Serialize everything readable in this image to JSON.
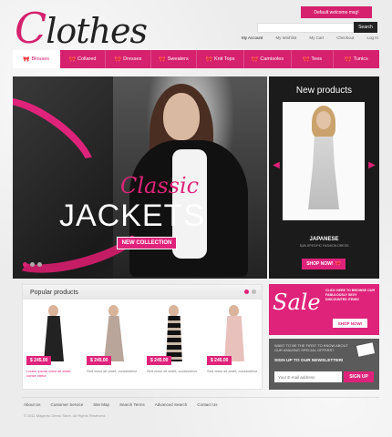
{
  "header": {
    "logo": "Clothes",
    "welcome": "Default welcome msg!",
    "search_placeholder": "",
    "search_button": "Search",
    "top_links": [
      "My Account",
      "My Wishlist",
      "My Cart",
      "Checkout",
      "Log In"
    ]
  },
  "nav": {
    "items": [
      "Blouses",
      "Collared",
      "Dresses",
      "Sweaters",
      "Knit Tops",
      "Camisoles",
      "Tees",
      "Tunics"
    ],
    "active": "Blouses"
  },
  "hero": {
    "classic": "Classic",
    "jackets": "JACKETS",
    "button": "NEW COLLECTION",
    "slide_count": 3,
    "active_slide": 1
  },
  "new_products": {
    "title": "New products",
    "product_name": "JAPANESE",
    "product_sub": "SUB-SPECIFIC FASHION DRESS",
    "button": "SHOP NOW!"
  },
  "popular": {
    "title": "Popular products",
    "items": [
      {
        "price": "$ 245.00",
        "desc": "Lorem ipsum dolor sit amet, conse ctetur"
      },
      {
        "price": "$ 245.00",
        "desc": "Sed dolor sit amet, consectetur"
      },
      {
        "price": "$ 245.00",
        "desc": "Sed dolor sit amet, consectetur"
      },
      {
        "price": "$ 245.00",
        "desc": "Sed dolor sit amet, consectetur"
      }
    ]
  },
  "sale": {
    "word": "Sale",
    "text": "CLICK HERE TO BROWSE OUR FABULOUSLY SEXY DISCOUNTED ITEMS!",
    "button": "SHOP NOW!"
  },
  "newsletter": {
    "line1": "WANT TO BE THE FIRST TO KNOW ABOUT OUR AMAZING SPECIAL OFFERS?",
    "line2": "SIGN UP TO OUR NEWSLETTER!",
    "placeholder": "Your E-mail address",
    "button": "SIGN UP"
  },
  "footer": {
    "links": [
      "About Us",
      "Customer Service",
      "Site Map",
      "Search Terms",
      "Advanced Search",
      "Contact Us"
    ],
    "copyright": "© 2011 Magento Demo Store. All Rights Reserved."
  },
  "colors": {
    "accent": "#e0237a",
    "dark": "#1b1b1b"
  }
}
